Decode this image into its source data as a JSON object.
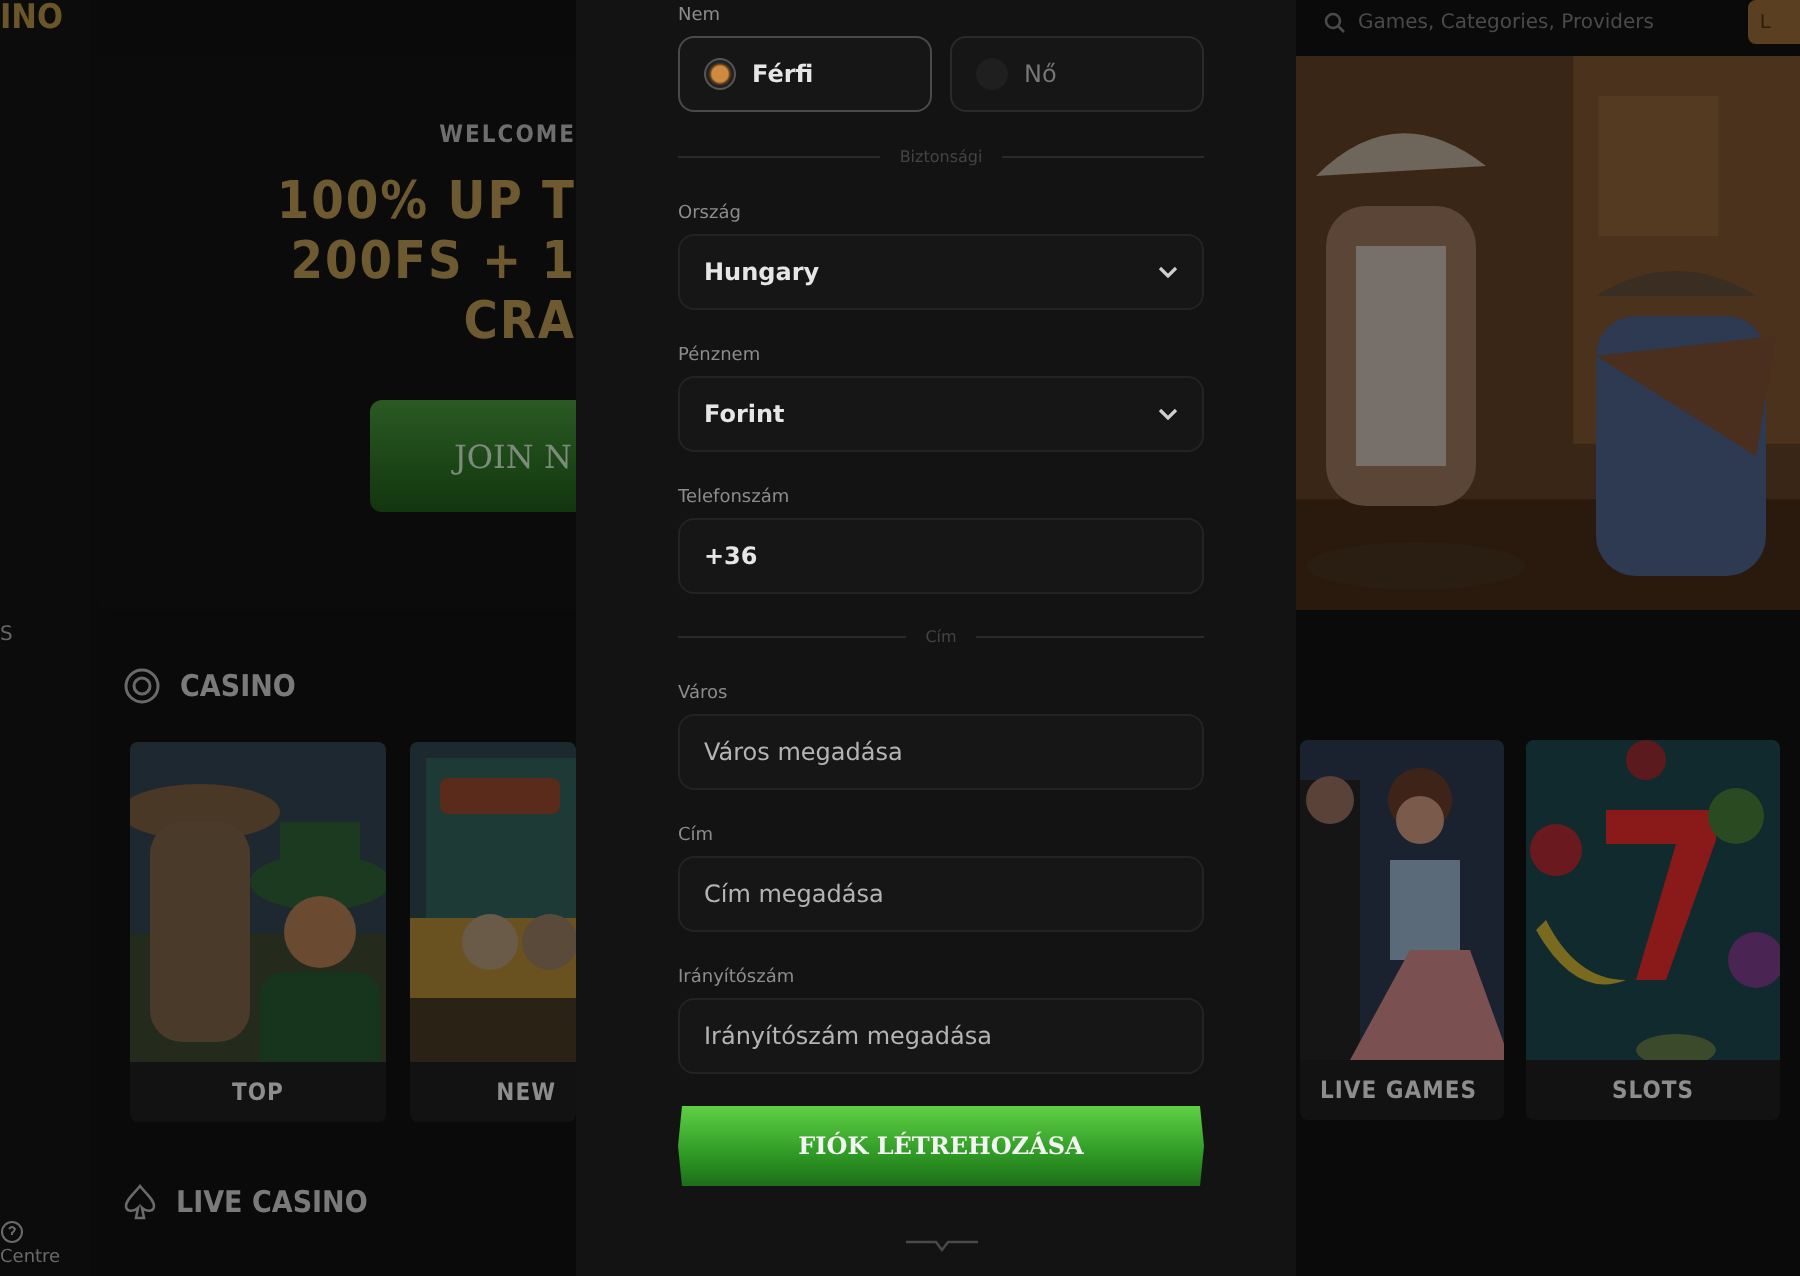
{
  "site": {
    "logo": "INO",
    "search_placeholder": "Games, Categories, Providers",
    "login_button": "L"
  },
  "sidebar": {
    "items": [
      {
        "kind": "link",
        "label": "S"
      },
      {
        "kind": "help",
        "label": "Centre"
      }
    ]
  },
  "hero": {
    "kicker": "WELCOME",
    "lines": [
      "100% UP T",
      "200FS + 1",
      "CRA"
    ],
    "button": "JOIN N"
  },
  "sections": [
    {
      "title": "CASINO",
      "cards": [
        {
          "label": "TOP"
        },
        {
          "label": "NEW"
        },
        {
          "label": "LIVE GAMES"
        },
        {
          "label": "SLOTS"
        }
      ]
    },
    {
      "title": "LIVE CASINO"
    }
  ],
  "registration": {
    "gender": {
      "label": "Nem",
      "options": [
        {
          "label": "Férfi",
          "selected": true
        },
        {
          "label": "Nő",
          "selected": false
        }
      ]
    },
    "fields": [
      {
        "kind": "divider",
        "label": "Biztonsági"
      },
      {
        "kind": "select",
        "label": "Ország",
        "value": "Hungary"
      },
      {
        "kind": "select",
        "label": "Pénznem",
        "value": "Forint"
      },
      {
        "kind": "text",
        "label": "Telefonszám",
        "value": "+36"
      },
      {
        "kind": "divider",
        "label": "Cím"
      },
      {
        "kind": "text",
        "label": "Város",
        "placeholder": "Város megadása"
      },
      {
        "kind": "text",
        "label": "Cím",
        "placeholder": "Cím megadása"
      },
      {
        "kind": "text",
        "label": "Irányítószám",
        "placeholder": "Irányítószám megadása"
      }
    ],
    "submit": "FIÓK LÉTREHOZÁSA"
  }
}
